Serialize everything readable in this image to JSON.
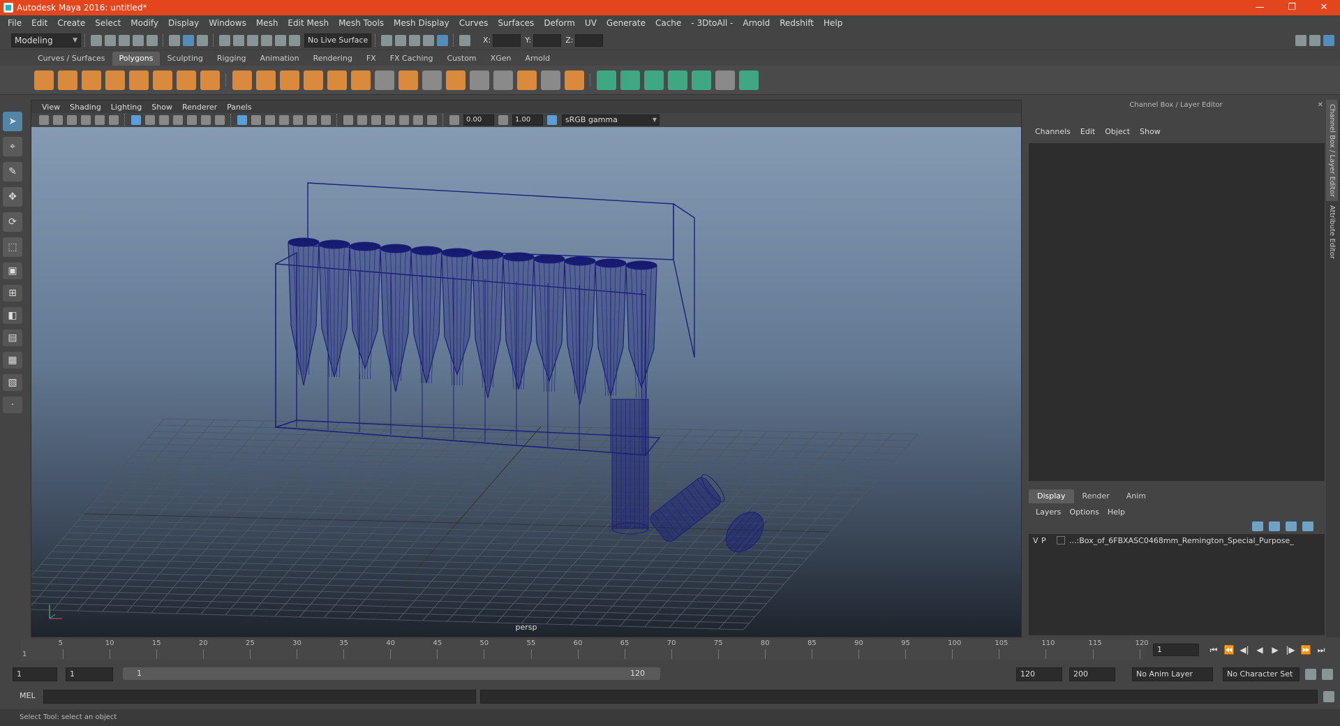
{
  "window": {
    "title": "Autodesk Maya 2016: untitled*",
    "buttons": [
      "—",
      "❐",
      "✕"
    ]
  },
  "menubar": [
    "File",
    "Edit",
    "Create",
    "Select",
    "Modify",
    "Display",
    "Windows",
    "Mesh",
    "Edit Mesh",
    "Mesh Tools",
    "Mesh Display",
    "Curves",
    "Surfaces",
    "Deform",
    "UV",
    "Generate",
    "Cache",
    "- 3DtoAll -",
    "Arnold",
    "Redshift",
    "Help"
  ],
  "statusline": {
    "mode": "Modeling",
    "live_surface": "No Live Surface",
    "x_label": "X:",
    "y_label": "Y:",
    "z_label": "Z:"
  },
  "shelf_tabs": [
    "Curves / Surfaces",
    "Polygons",
    "Sculpting",
    "Rigging",
    "Animation",
    "Rendering",
    "FX",
    "FX Caching",
    "Custom",
    "XGen",
    "Arnold"
  ],
  "shelf_active": "Polygons",
  "viewport": {
    "menu": [
      "View",
      "Shading",
      "Lighting",
      "Show",
      "Renderer",
      "Panels"
    ],
    "exposure": "0.00",
    "gamma": "1.00",
    "color_space": "sRGB gamma",
    "camera": "persp"
  },
  "right_panel": {
    "header": "Channel Box / Layer Editor",
    "menu": [
      "Channels",
      "Edit",
      "Object",
      "Show"
    ],
    "layer_tabs": [
      "Display",
      "Render",
      "Anim"
    ],
    "layer_menu": [
      "Layers",
      "Options",
      "Help"
    ],
    "layer": {
      "v": "V",
      "p": "P",
      "name": "...:Box_of_6FBXASC0468mm_Remington_Special_Purpose_"
    },
    "side_tabs": [
      "Channel Box / Layer Editor",
      "Attribute Editor"
    ]
  },
  "timeline": {
    "ticks": [
      "5",
      "10",
      "15",
      "20",
      "25",
      "30",
      "35",
      "40",
      "45",
      "50",
      "55",
      "60",
      "65",
      "70",
      "75",
      "80",
      "85",
      "90",
      "95",
      "100",
      "105",
      "110",
      "115",
      "120"
    ],
    "start_marker": "1",
    "current_frame": "1",
    "playback": [
      "⏮",
      "⏪",
      "◀|",
      "◀",
      "▶",
      "|▶",
      "⏩",
      "⏭"
    ]
  },
  "range": {
    "start": "1",
    "playback_start": "1",
    "slider_start": "1",
    "slider_end": "120",
    "playback_end": "120",
    "end": "200",
    "anim_layer": "No Anim Layer",
    "character_set": "No Character Set"
  },
  "command": {
    "label": "MEL"
  },
  "help_line": "Select Tool: select an object"
}
